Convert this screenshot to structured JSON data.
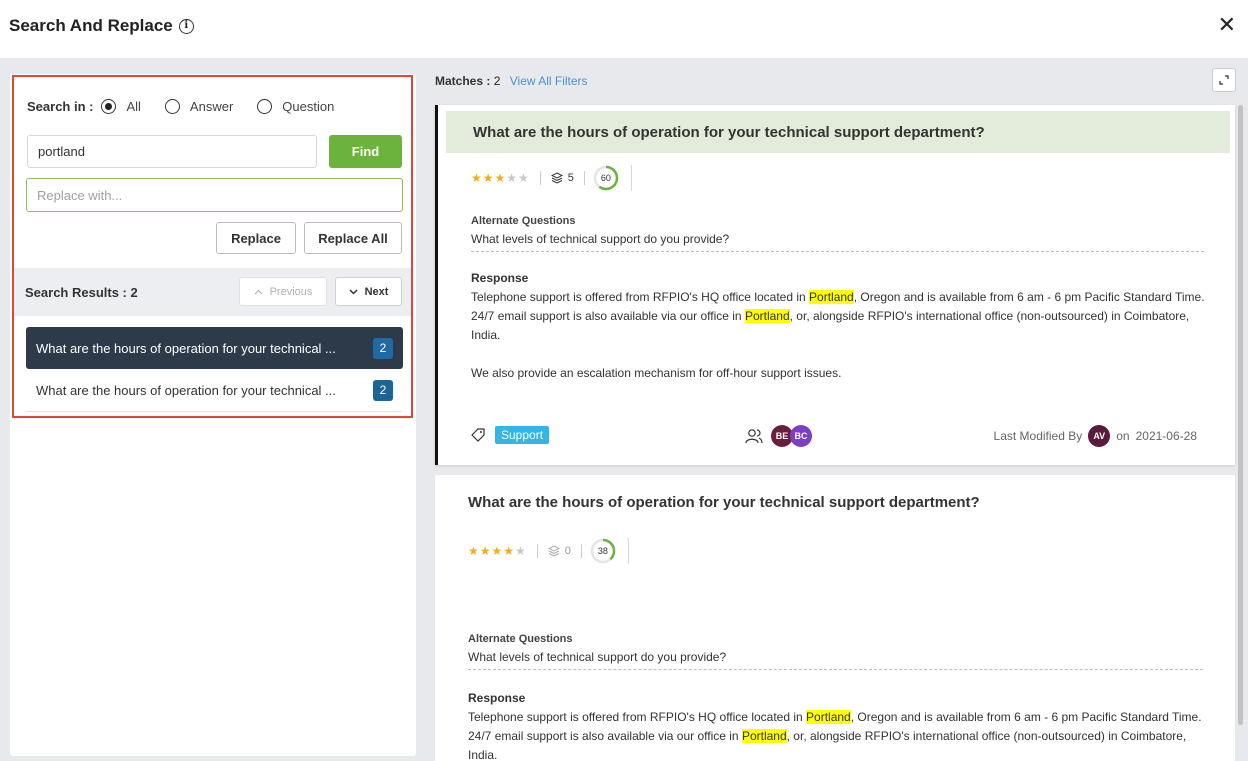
{
  "header": {
    "title": "Search And Replace",
    "close_label": "✕"
  },
  "search": {
    "label": "Search in :",
    "options": [
      "All",
      "Answer",
      "Question"
    ],
    "selected": "All",
    "find_value": "portland",
    "find_label": "Find",
    "replace_placeholder": "Replace with...",
    "replace_label": "Replace",
    "replace_all_label": "Replace All"
  },
  "results": {
    "label": "Search Results : 2",
    "previous_label": "Previous",
    "next_label": "Next",
    "items": [
      {
        "text": "What are the hours of operation for your technical ...",
        "count": "2"
      },
      {
        "text": "What are the hours of operation for your technical ...",
        "count": "2"
      }
    ]
  },
  "matches": {
    "label": "Matches :",
    "count": "2",
    "view_filters": "View All Filters"
  },
  "cards": [
    {
      "question": "What are the hours of operation for your technical support department?",
      "rating": 3,
      "layers": "5",
      "score": "60",
      "alt_label": "Alternate Questions",
      "alt_question": "What levels of technical support do you provide?",
      "resp_label": "Response",
      "resp_l1_a": "Telephone support is offered from RFPIO's HQ office located in ",
      "hl1": "Portland",
      "resp_l1_b": ", Oregon and is available from 6 am - 6 pm Pacific Standard Time.",
      "resp_l2_a": "24/7 email support is also available via our office in ",
      "hl2": "Portland",
      "resp_l2_b": ", or, alongside RFPIO's international office (non-outsourced) in Coimbatore, India.",
      "resp_l3": "We also provide an escalation mechanism for off-hour support issues.",
      "tag": "Support",
      "avatars": [
        "BE",
        "BC"
      ],
      "last_modified_label": "Last Modified By",
      "modifier": "AV",
      "date_prefix": "on",
      "date": "2021-06-28"
    },
    {
      "question": "What are the hours of operation for your technical support department?",
      "rating": 4,
      "layers": "0",
      "score": "38",
      "alt_label": "Alternate Questions",
      "alt_question": "What levels of technical support do you provide?",
      "resp_label": "Response",
      "resp_l1_a": "Telephone support is offered from RFPIO's HQ office located in ",
      "hl1": "Portland",
      "resp_l1_b": ", Oregon and is available from 6 am - 6 pm Pacific Standard Time.",
      "resp_l2_a": "24/7 email support is also available via our office in ",
      "hl2": "Portland",
      "resp_l2_b": ", or, alongside RFPIO's international office (non-outsourced) in Coimbatore, India."
    }
  ],
  "colors": {
    "accent_green": "#6bb33d",
    "dark_nav": "#2d3a4a",
    "badge_blue": "#1a6496",
    "highlight": "#ffff00",
    "tag_blue": "#33b5e5",
    "search_border": "#e0463a"
  }
}
